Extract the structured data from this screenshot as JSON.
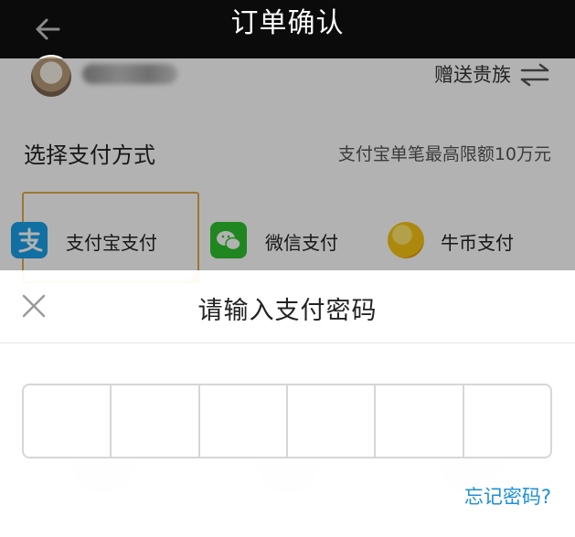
{
  "header": {
    "title": "订单确认",
    "back_icon": "arrow-left-icon"
  },
  "user": {
    "gift_label": "赠送贵族",
    "swap_icon": "swap-arrows-icon"
  },
  "payment": {
    "title": "选择支付方式",
    "limit_note": "支付宝单笔最高限额10万元",
    "methods": [
      {
        "label": "支付宝支付",
        "icon": "alipay-icon",
        "selected": true
      },
      {
        "label": "微信支付",
        "icon": "wechat-icon",
        "selected": false
      },
      {
        "label": "牛币支付",
        "icon": "coin-icon",
        "selected": false
      }
    ]
  },
  "password_dialog": {
    "title": "请输入支付密码",
    "close_icon": "close-icon",
    "digit_count": 6,
    "forgot_link": "忘记密码?"
  },
  "colors": {
    "titlebar": "#0b0b0b",
    "selected_border": "#e2a94a",
    "link": "#1e8fd8",
    "alipay": "#1aa0e8",
    "wechat": "#2ec12f"
  }
}
